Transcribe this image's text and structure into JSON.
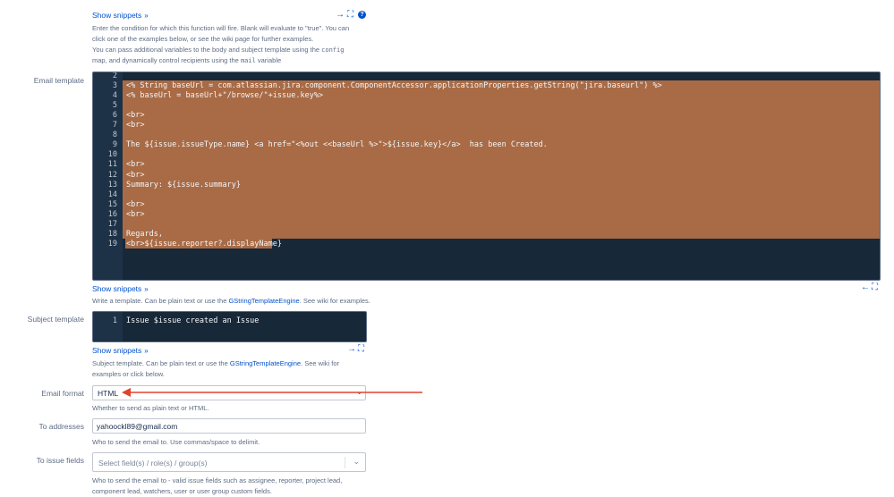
{
  "top": {
    "show_snippets": "Show snippets",
    "help_line1": "Enter the condition for which this function will fire. Blank will evaluate to \"true\". You can",
    "help_line2": "click one of the examples below, or see the wiki page for further examples.",
    "help_line3_a": "You can pass additional variables to the body and subject template using the",
    "help_line3_code": "config",
    "help_line4_a": "map, and dynamically control recipients using the",
    "help_line4_code": "mail",
    "help_line4_b": "variable"
  },
  "email_template": {
    "label": "Email template",
    "lines": [
      {
        "n": "2",
        "text": ""
      },
      {
        "n": "3",
        "text": "<% String baseUrl = com.atlassian.jira.component.ComponentAccessor.applicationProperties.getString(\"jira.baseurl\") %>"
      },
      {
        "n": "4",
        "text": "<% baseUrl = baseUrl+\"/browse/\"+issue.key%>"
      },
      {
        "n": "5",
        "text": ""
      },
      {
        "n": "6",
        "text": "<br>"
      },
      {
        "n": "7",
        "text": "<br>"
      },
      {
        "n": "8",
        "text": ""
      },
      {
        "n": "9",
        "text": "The ${issue.issueType.name} <a href=\"<%out <<baseUrl %>\">${issue.key}</a>  has been Created."
      },
      {
        "n": "10",
        "text": ""
      },
      {
        "n": "11",
        "text": "<br>"
      },
      {
        "n": "12",
        "text": "<br>"
      },
      {
        "n": "13",
        "text": "Summary: ${issue.summary}"
      },
      {
        "n": "14",
        "text": ""
      },
      {
        "n": "15",
        "text": "<br>"
      },
      {
        "n": "16",
        "text": "<br>"
      },
      {
        "n": "17",
        "text": ""
      },
      {
        "n": "18",
        "text": "Regards,"
      },
      {
        "n": "19",
        "text": "<br>${issue.reporter?.displayName}"
      }
    ],
    "show_snippets": "Show snippets",
    "help_a": "Write a template. Can be plain text or use the",
    "help_link": "GStringTemplateEngine",
    "help_b": ". See wiki for examples."
  },
  "subject_template": {
    "label": "Subject template",
    "line_number": "1",
    "line_text": "Issue $issue created an Issue",
    "show_snippets": "Show snippets",
    "help_a": "Subject template. Can be plain text or use the",
    "help_link": "GStringTemplateEngine",
    "help_b": ". See wiki for",
    "help_c": "examples or click below."
  },
  "email_format": {
    "label": "Email format",
    "value": "HTML",
    "help": "Whether to send as plain text or HTML."
  },
  "to_addresses": {
    "label": "To addresses",
    "value": "yahoockl89@gmail.com",
    "help": "Who to send the email to. Use commas/space to delimit."
  },
  "to_issue_fields": {
    "label": "To issue fields",
    "placeholder": "Select field(s) / role(s) / group(s)",
    "help_line1": "Who to send the email to - valid issue fields such as assignee, reporter, project lead,",
    "help_line2": "component lead, watchers, user or user group custom fields."
  },
  "colors": {
    "accent": "#0052cc",
    "editor_bg": "#172839",
    "selection": "#a86b46",
    "arrow": "#e0442c"
  }
}
